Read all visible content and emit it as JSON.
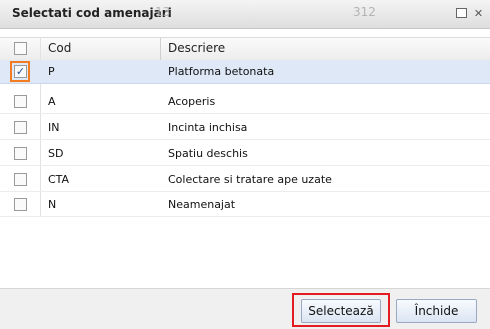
{
  "dialog": {
    "title": "Selectati cod amenajari",
    "ghost_text_1": "13",
    "ghost_text_2": "312",
    "maximize_icon": "maximize-icon",
    "close_icon": "close-icon",
    "close_glyph": "✕"
  },
  "table": {
    "headers": {
      "code": "Cod",
      "description": "Descriere"
    },
    "rows": [
      {
        "code": "P",
        "description": "Platforma betonata",
        "checked": true,
        "selected": true
      },
      {
        "code": "A",
        "description": "Acoperis",
        "checked": false
      },
      {
        "code": "IN",
        "description": "Incinta inchisa",
        "checked": false
      },
      {
        "code": "SD",
        "description": "Spatiu deschis",
        "checked": false
      },
      {
        "code": "CTA",
        "description": "Colectare si tratare ape uzate",
        "checked": false
      },
      {
        "code": "N",
        "description": "Neamenajat",
        "checked": false
      }
    ],
    "check_glyph": "✓"
  },
  "footer": {
    "select_label": "Selectează",
    "close_label": "Închide"
  },
  "colors": {
    "selected_row": "#dfe8f6",
    "highlight_checkbox": "#f47c20",
    "highlight_button": "#e31b23"
  }
}
